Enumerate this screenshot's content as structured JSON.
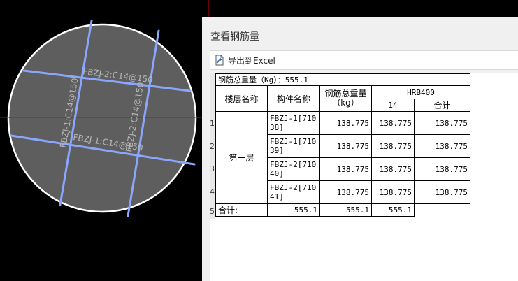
{
  "canvas": {
    "background": "#000000",
    "disc_fill": "#5e5e5e",
    "rebar_color": "#8aa6ff",
    "crosshair_color": "#e00000",
    "labels": [
      "FBZJ-2:C14@150",
      "FBZJ-1:C14@150",
      "FBZJ-2:C14@150",
      "FBZJ-1:C14@150"
    ]
  },
  "dialog": {
    "title": "查看钢筋量",
    "export_label": "导出到Excel",
    "summary": "钢筋总重量（Kg）：555.1",
    "headers": {
      "floor": "楼层名称",
      "component": "构件名称",
      "total_weight": "钢筋总重量（kg）",
      "grade": "HRB400",
      "diameter": "14",
      "subtotal": "合计"
    },
    "row_numbers": [
      "1",
      "2",
      "3",
      "4",
      "5"
    ],
    "floor_name": "第一层",
    "rows": [
      {
        "component": "FBZJ-1[71038]",
        "total": "138.775",
        "d14": "138.775",
        "sum": "138.775"
      },
      {
        "component": "FBZJ-1[71039]",
        "total": "138.775",
        "d14": "138.775",
        "sum": "138.775"
      },
      {
        "component": "FBZJ-2[71040]",
        "total": "138.775",
        "d14": "138.775",
        "sum": "138.775"
      },
      {
        "component": "FBZJ-2[71041]",
        "total": "138.775",
        "d14": "138.775",
        "sum": "138.775"
      }
    ],
    "total_row": {
      "label": "合计:",
      "total": "555.1",
      "d14": "555.1",
      "sum": "555.1"
    }
  }
}
